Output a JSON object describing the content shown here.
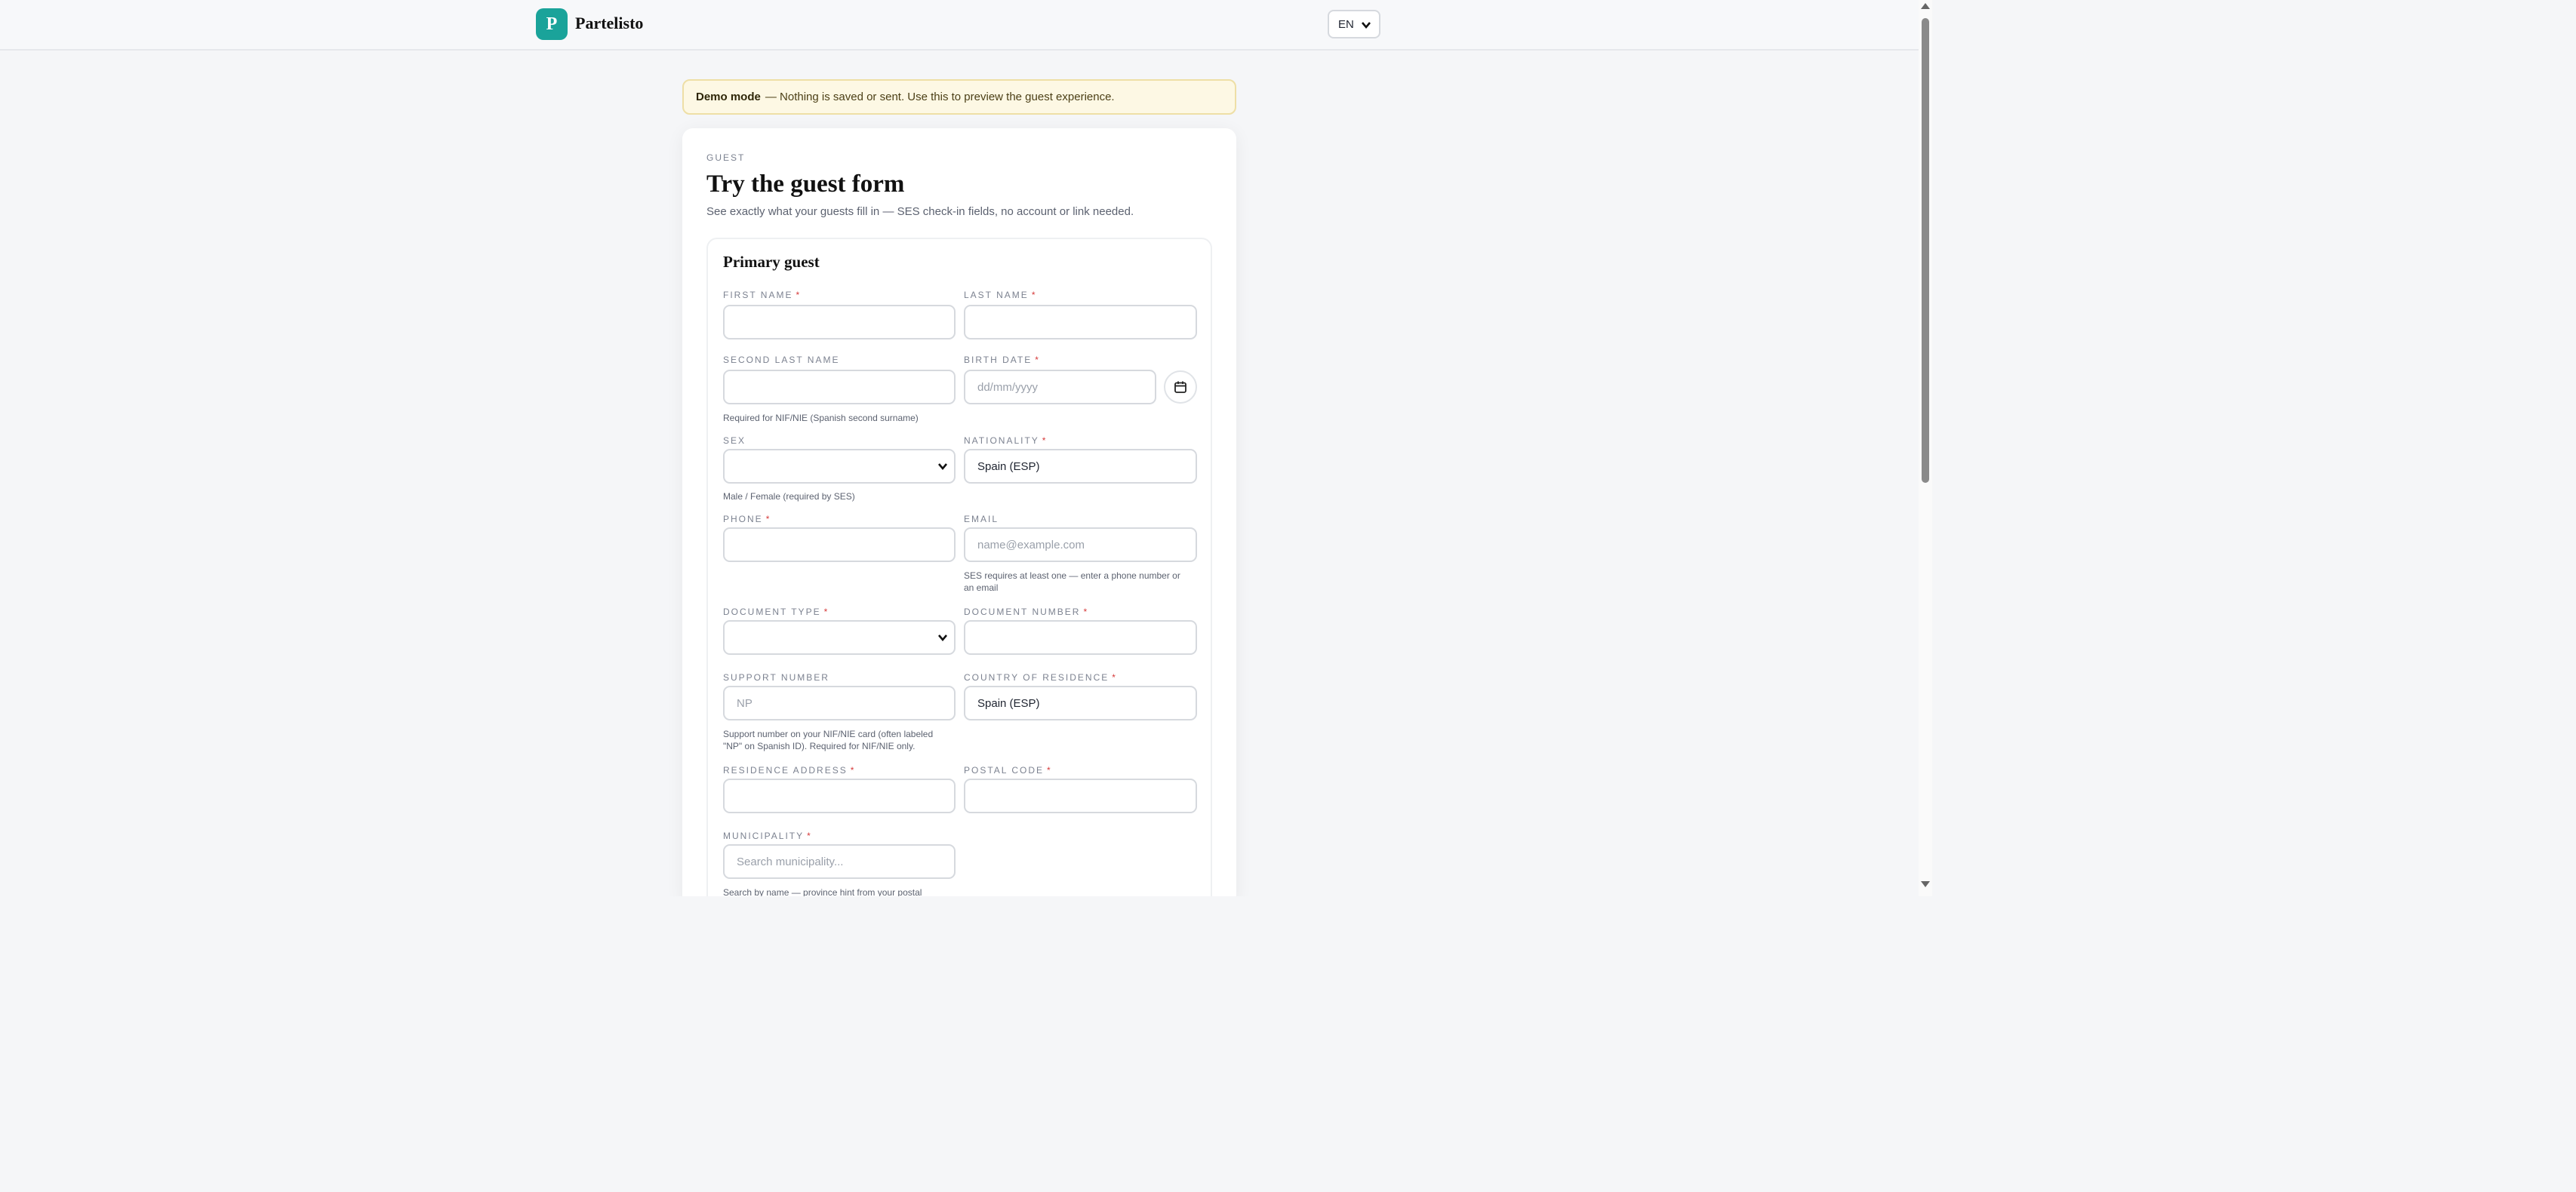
{
  "header": {
    "logo_letter": "P",
    "brand": "Partelisto",
    "language": "EN"
  },
  "banner": {
    "strong": "Demo mode",
    "text": "— Nothing is saved or sent. Use this to preview the guest experience."
  },
  "card": {
    "eyebrow": "GUEST",
    "title": "Try the guest form",
    "subtitle": "See exactly what your guests fill in — SES check-in fields, no account or link needed."
  },
  "form": {
    "section_title": "Primary guest",
    "required_marker": "*",
    "first_name": {
      "label": "FIRST NAME"
    },
    "last_name": {
      "label": "LAST NAME"
    },
    "second_last_name": {
      "label": "SECOND LAST NAME",
      "hint": "Required for NIF/NIE (Spanish second surname)"
    },
    "birth_date": {
      "label": "BIRTH DATE",
      "placeholder": "dd/mm/yyyy"
    },
    "sex": {
      "label": "SEX",
      "hint": "Male / Female (required by SES)"
    },
    "nationality": {
      "label": "NATIONALITY",
      "value": "Spain (ESP)"
    },
    "phone": {
      "label": "PHONE"
    },
    "email": {
      "label": "EMAIL",
      "placeholder": "name@example.com",
      "hint_line1": "SES requires at least one — enter a phone number or",
      "hint_line2": "an email"
    },
    "document_type": {
      "label": "DOCUMENT TYPE"
    },
    "document_number": {
      "label": "DOCUMENT NUMBER"
    },
    "support_number": {
      "label": "SUPPORT NUMBER",
      "placeholder": "NP",
      "hint_line1": "Support number on your NIF/NIE card (often labeled",
      "hint_line2": "\"NP\" on Spanish ID). Required for NIF/NIE only."
    },
    "country_of_residence": {
      "label": "COUNTRY OF RESIDENCE",
      "value": "Spain (ESP)"
    },
    "residence_address": {
      "label": "RESIDENCE ADDRESS"
    },
    "postal_code": {
      "label": "POSTAL CODE"
    },
    "municipality": {
      "label": "MUNICIPALITY",
      "placeholder": "Search municipality...",
      "hint": "Search by name — province hint from your postal"
    }
  },
  "colors": {
    "brand": "#1aa39a",
    "required": "#d63a3a",
    "banner_bg": "#fdf8e4"
  }
}
